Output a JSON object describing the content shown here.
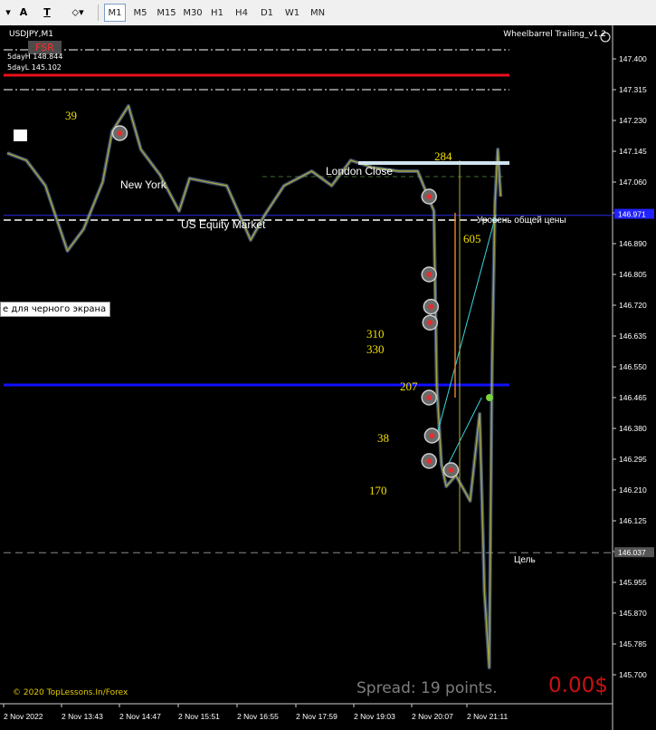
{
  "toolbar": {
    "buttons": [
      {
        "name": "expand-arrow-icon",
        "label": "▾"
      },
      {
        "name": "text-tool-button",
        "label": "A"
      },
      {
        "name": "text-label-tool-button",
        "label": "T"
      },
      {
        "name": "shapes-menu-button",
        "label": "⬦▾"
      }
    ],
    "timeframes": [
      "M1",
      "M5",
      "M15",
      "M30",
      "H1",
      "H4",
      "D1",
      "W1",
      "MN"
    ],
    "active_timeframe": "M1"
  },
  "chart": {
    "symbol_title": "USDJPY,M1",
    "indicator_name": "Wheelbarrel Trailing_v1.2",
    "sr_label": "FSR",
    "five_day_high": "5dayH 148.844",
    "five_day_low": "5dayL 145.102",
    "tooltip": "е для черного экрана",
    "copyright": "© 2020 TopLessons.In/Forex",
    "spread": "Spread: 19 points.",
    "profit": "0.00$",
    "labels": {
      "new_york": "New York",
      "london_close": "London Close",
      "us_equity": "US Equity Market",
      "general_price_level": "Уровень общей цены",
      "target": "Цель"
    },
    "numbers": [
      "39",
      "284",
      "605",
      "310",
      "330",
      "207",
      "38",
      "170"
    ]
  },
  "chart_data": {
    "type": "line",
    "symbol": "USDJPY",
    "timeframe": "M1",
    "y_axis": {
      "ticks": [
        "147.400",
        "147.315",
        "147.230",
        "147.145",
        "147.060",
        "146.975",
        "146.890",
        "146.805",
        "146.720",
        "146.635",
        "146.550",
        "146.465",
        "146.380",
        "146.295",
        "146.210",
        "146.125",
        "146.040",
        "145.955",
        "145.870",
        "145.785",
        "145.700"
      ],
      "ylim": [
        145.68,
        147.47
      ],
      "current_price": "146.971",
      "target_price": "146.037"
    },
    "x_axis": {
      "ticks": [
        "2 Nov 2022",
        "2 Nov 13:43",
        "2 Nov 14:47",
        "2 Nov 15:51",
        "2 Nov 16:55",
        "2 Nov 17:59",
        "2 Nov 19:03",
        "2 Nov 20:07",
        "2 Nov 21:11"
      ]
    },
    "price_series": {
      "x": [
        "12:40",
        "13:00",
        "13:20",
        "13:43",
        "14:00",
        "14:20",
        "14:30",
        "14:47",
        "15:00",
        "15:20",
        "15:40",
        "15:51",
        "16:10",
        "16:30",
        "16:55",
        "17:10",
        "17:30",
        "17:59",
        "18:20",
        "18:40",
        "19:03",
        "19:30",
        "19:50",
        "20:07",
        "20:10",
        "20:15",
        "20:20",
        "20:30",
        "20:45",
        "20:55",
        "21:00",
        "21:05",
        "21:08",
        "21:11",
        "21:14",
        "21:17"
      ],
      "y": [
        147.14,
        147.12,
        147.05,
        146.87,
        146.93,
        147.06,
        147.2,
        147.27,
        147.15,
        147.08,
        146.98,
        147.07,
        147.06,
        147.05,
        146.9,
        146.97,
        147.05,
        147.09,
        147.05,
        147.12,
        147.1,
        147.09,
        147.09,
        146.98,
        146.5,
        146.28,
        146.22,
        146.25,
        146.18,
        146.42,
        145.93,
        145.72,
        146.55,
        147.0,
        147.15,
        147.02
      ]
    },
    "levels": [
      {
        "kind": "red-thick",
        "price": 147.355
      },
      {
        "kind": "white-dashdot-top",
        "price": 147.425
      },
      {
        "kind": "white-dashdot-low",
        "price": 147.315
      },
      {
        "kind": "blue-thin",
        "price": 146.968
      },
      {
        "kind": "white-dashed",
        "price": 146.955
      },
      {
        "kind": "blue-thick",
        "price": 146.5
      },
      {
        "kind": "gray-dashed-target",
        "price": 146.037
      }
    ],
    "markers": [
      {
        "time": "14:38",
        "price": 147.195
      },
      {
        "time": "20:02",
        "price": 147.02
      },
      {
        "time": "20:02",
        "price": 146.805
      },
      {
        "time": "20:04",
        "price": 146.716
      },
      {
        "time": "20:03",
        "price": 146.672
      },
      {
        "time": "20:02",
        "price": 146.465
      },
      {
        "time": "20:05",
        "price": 146.36
      },
      {
        "time": "20:02",
        "price": 146.29
      },
      {
        "time": "20:25",
        "price": 146.265
      }
    ],
    "trend_lines": [
      {
        "from": {
          "time": "20:10",
          "price": 146.36
        },
        "to": {
          "time": "21:12",
          "price": 146.97
        }
      },
      {
        "from": {
          "time": "20:20",
          "price": 146.27
        },
        "to": {
          "time": "20:57",
          "price": 146.465
        }
      }
    ],
    "grid": false,
    "legend": "none"
  }
}
